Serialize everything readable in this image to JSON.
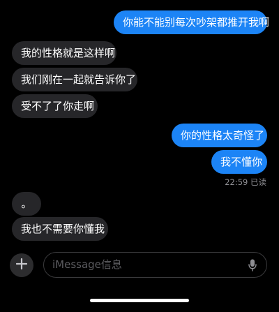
{
  "messages": [
    {
      "text": "你能不能别每次吵架都推开我啊",
      "side": "out"
    },
    {
      "text": "我的性格就是这样啊",
      "side": "in"
    },
    {
      "text": "我们刚在一起就告诉你了",
      "side": "in"
    },
    {
      "text": "受不了了你走啊",
      "side": "in"
    },
    {
      "text": "你的性格太奇怪了",
      "side": "out"
    },
    {
      "text": "我不懂你",
      "side": "out"
    },
    {
      "text": "。",
      "side": "in"
    },
    {
      "text": "我也不需要你懂我",
      "side": "in"
    }
  ],
  "read_receipt": "22:59 已读",
  "composer": {
    "placeholder": "iMessage信息",
    "plus_icon": "plus-icon",
    "mic_icon": "microphone-icon"
  },
  "colors": {
    "outgoing": "#1c84f6",
    "incoming": "#262629",
    "background": "#000000"
  }
}
